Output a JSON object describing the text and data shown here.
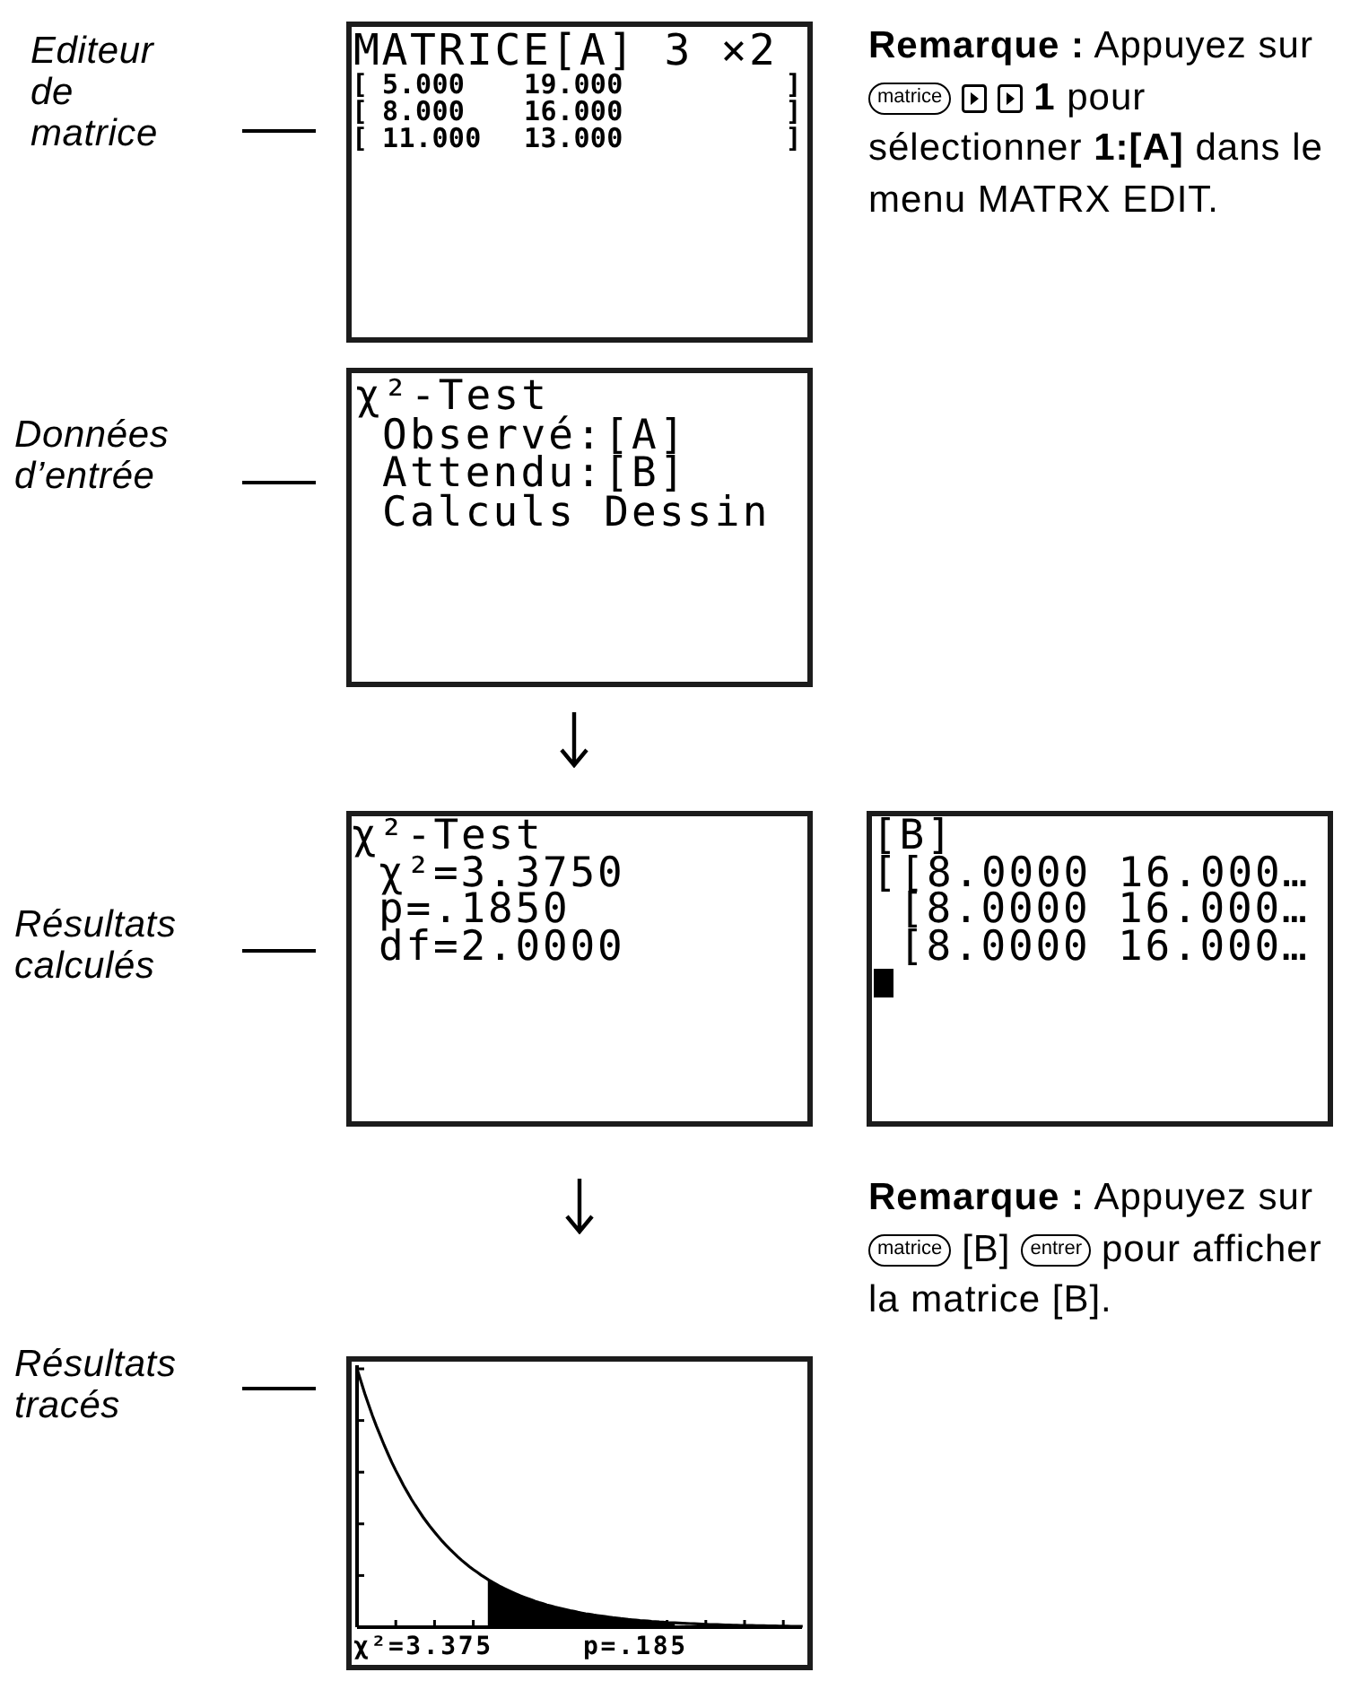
{
  "matrix_step": {
    "label": "Editeur de matrice",
    "screen": {
      "title": "MATRICE[A] 3 ×2",
      "rows": [
        {
          "open": "[",
          "values": [
            "5.000",
            "19.000"
          ],
          "close": "]"
        },
        {
          "open": "[",
          "values": [
            "8.000",
            "16.000"
          ],
          "close": "]"
        },
        {
          "open": "[",
          "values": [
            "11.000",
            "13.000"
          ],
          "close": "]"
        }
      ]
    },
    "note": {
      "parts": [
        {
          "kind": "text",
          "text": "**Remarque :** Appuyez sur"
        },
        {
          "kind": "key",
          "label": "matrice"
        },
        {
          "kind": "arrow_key"
        },
        {
          "kind": "arrow_key"
        },
        {
          "kind": "text",
          "text": "**1** pour"
        },
        {
          "kind": "text",
          "text": "sélectionner **1:[A]** dans le menu MATRX EDIT."
        }
      ]
    }
  },
  "input_step": {
    "label": "Données d’entrée",
    "screen": {
      "title": "χ²-Test",
      "lines": [
        "Observé:[A]",
        "Attendu:[B]",
        "Calculs Dessin"
      ]
    }
  },
  "results_step": {
    "label": "Résultats calculés",
    "screen": {
      "title": "χ²-Test",
      "lines": [
        "χ²=3.3750",
        "p=.1850",
        "df=2.0000"
      ]
    },
    "matrix_b_screen": {
      "title": "[B]",
      "rows": [
        "[[8.0000 16.000…",
        "[8.0000 16.000…",
        "[8.0000 16.000…"
      ]
    }
  },
  "note_2": {
    "parts": [
      {
        "kind": "text",
        "text": "**Remarque :** Appuyez sur"
      },
      {
        "kind": "key",
        "label": "matrice"
      },
      {
        "kind": "text",
        "text": "[B]"
      },
      {
        "kind": "key",
        "label": "entrer"
      },
      {
        "kind": "text",
        "text": "pour afficher"
      },
      {
        "kind": "text",
        "text": "la matrice [B]."
      }
    ]
  },
  "graph_step": {
    "label": "Résultats tracés",
    "screen": {
      "readouts": [
        "χ²=3.375",
        "p=.185"
      ]
    }
  }
}
